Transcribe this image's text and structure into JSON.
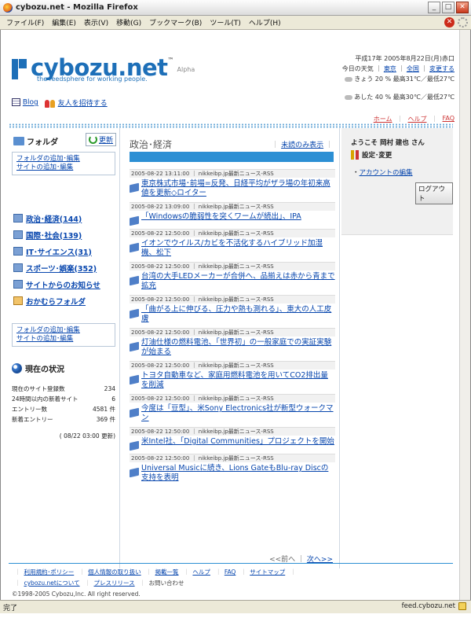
{
  "window": {
    "title": "cybozu.net - Mozilla Firefox"
  },
  "menu": [
    "ファイル(F)",
    "編集(E)",
    "表示(V)",
    "移動(G)",
    "ブックマーク(B)",
    "ツール(T)",
    "ヘルプ(H)"
  ],
  "header": {
    "logo_text": "cybozu.net",
    "logo_tm": "™",
    "logo_alpha": "Alpha",
    "tagline": "the feedsphere for working people.",
    "date": "平成17年 2005年8月22日(月)赤口",
    "weather_label": "今日の天気",
    "weather_region_1": "東京",
    "weather_region_2": "全国",
    "weather_change": "変更する",
    "today_line": "きょう  20 %   最高31℃／最低27℃",
    "tomorrow_line": "あした  40 %   最高30℃／最低27℃",
    "blog_link": "Blog",
    "invite_link": "友人を招待する",
    "home_link": "ホーム",
    "help_link": "ヘルプ",
    "faq_link": "FAQ"
  },
  "left": {
    "folder_title": "フォルダ",
    "update_label": "更新",
    "add_folder": "フォルダの追加･編集",
    "add_site": "サイトの追加･編集",
    "folders": [
      {
        "label": "政治･経済(144)"
      },
      {
        "label": "国際･社会(139)"
      },
      {
        "label": "IT･サイエンス(31)"
      },
      {
        "label": "スポーツ･娯楽(352)"
      },
      {
        "label": "サイトからのお知らせ"
      },
      {
        "label": "おかむらフォルダ"
      }
    ],
    "status_title": "現在の状況",
    "stats": [
      {
        "label": "現在のサイト登録数",
        "value": "234"
      },
      {
        "label": "24時間以内の新着サイト",
        "value": "6"
      },
      {
        "label": "エントリー数",
        "value": "4581 件"
      },
      {
        "label": "新着エントリー",
        "value": "369 件"
      }
    ],
    "stats_updated": "( 08/22 03:00 更新)"
  },
  "main": {
    "title": "政治･経済",
    "unread_only": "未読のみ表示",
    "entries": [
      {
        "meta": "2005-08-22 13:11:00 ｜ nikkeibp.jp最新ニュース-RSS",
        "title": "東京株式市場･前場=反発、日経平均がザラ場の年初来高値を更新◇ロイター"
      },
      {
        "meta": "2005-08-22 13:09:00 ｜ nikkeibp.jp最新ニュース-RSS",
        "title": "「Windowsの脆弱性を突くワームが続出」、IPA"
      },
      {
        "meta": "2005-08-22 12:50:00 ｜ nikkeibp.jp最新ニュース-RSS",
        "title": "イオンでウイルス/カビを不活化するハイブリッド加湿機、松下"
      },
      {
        "meta": "2005-08-22 12:50:00 ｜ nikkeibp.jp最新ニュース-RSS",
        "title": "台湾の大手LEDメーカーが合併へ、品揃えは赤から青まで拡充"
      },
      {
        "meta": "2005-08-22 12:50:00 ｜ nikkeibp.jp最新ニュース-RSS",
        "title": "「曲がる上に伸びる、圧力や熱も測れる」、東大の人工皮膚"
      },
      {
        "meta": "2005-08-22 12:50:00 ｜ nikkeibp.jp最新ニュース-RSS",
        "title": "灯油仕様の燃料電池、「世界初」の一般家庭での実証実験が始まる"
      },
      {
        "meta": "2005-08-22 12:50:00 ｜ nikkeibp.jp最新ニュース-RSS",
        "title": "トヨタ自動車など、家庭用燃料電池を用いてCO2排出量を削減"
      },
      {
        "meta": "2005-08-22 12:50:00 ｜ nikkeibp.jp最新ニュース-RSS",
        "title": "今度は「豆型」、米Sony Electronics社が新型ウォークマン"
      },
      {
        "meta": "2005-08-22 12:50:00 ｜ nikkeibp.jp最新ニュース-RSS",
        "title": "米Intel社、「Digital Communities」プロジェクトを開始"
      },
      {
        "meta": "2005-08-22 12:50:00 ｜ nikkeibp.jp最新ニュース-RSS",
        "title": "Universal Musicに続き、Lions GateもBlu-ray Discの支持を表明"
      }
    ],
    "prev": "<<前へ",
    "next": "次へ>>"
  },
  "right": {
    "welcome": "ようこそ  岡村 建也 さん",
    "settings": "設定･変更",
    "account_edit": "アカウントの編集",
    "logout": "ログアウト"
  },
  "footer": {
    "links_row1": [
      "利用規約･ポリシー",
      "個人情報の取り扱い",
      "掲載一覧",
      "ヘルプ",
      "FAQ",
      "サイトマップ"
    ],
    "links_row2": [
      "cybozu.netについて",
      "プレスリリース"
    ],
    "contact": "お問い合わせ",
    "copyright": "©1998-2005 Cybozu,Inc. All right reserved."
  },
  "statusbar": {
    "left": "完了",
    "right": "feed.cybozu.net"
  }
}
